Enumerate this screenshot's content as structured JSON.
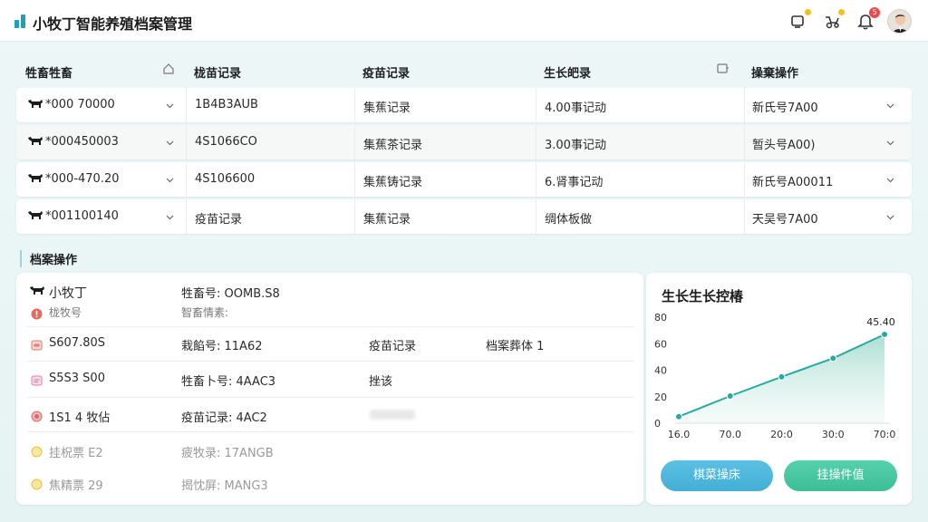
{
  "app": {
    "title": "小牧丁智能养殖档案管理"
  },
  "header": {
    "icons": [
      "device-icon",
      "tractor-icon",
      "bell-icon"
    ],
    "notification_count": "5",
    "colors": {
      "brand": "#1aa3b6",
      "badge": "#e84c4c",
      "dot": "#f2c21a"
    }
  },
  "table": {
    "columns": [
      "牲畜牲畜",
      "栊苗记录",
      "疫苗记录",
      "生长皅录",
      "操棄操作"
    ],
    "rows": [
      [
        "*000 70000",
        "1B4B3AUB",
        "集蕉记录",
        "4.00事记动",
        "新氏号7A00"
      ],
      [
        "*000450003",
        "4S1066CO",
        "集蕉茶记录",
        "3.00事记动",
        "暂头号A00)"
      ],
      [
        "*000-470.20",
        "4S106600",
        "集蕉铸记录",
        "6.肾事记动",
        "新氏号A00011"
      ],
      [
        "*001100140",
        "疫苗记录",
        "集蕉记录",
        "绸体板做",
        "天吴号7A00"
      ]
    ]
  },
  "section": {
    "title": "档案操作"
  },
  "detail": {
    "name": "小牧丁",
    "livestock_no": "牲畜号: OOMB.S8",
    "sub_label": "栊牧号",
    "smart_info": "智畜情素:",
    "rows": [
      {
        "left": "S607.80S",
        "mid": "栽餡号: 11A62",
        "c3": "疫苗记录",
        "c4": "档案葬体 1"
      },
      {
        "left": "S5S3 S00",
        "mid": "牲畜卜号: 4AAC3",
        "c3": "挫该",
        "c4": ""
      },
      {
        "left": "1S1 4 牧佔",
        "mid": "疫苗记录: 4AC2",
        "c3": "",
        "c4": ""
      },
      {
        "left": "挂柷票 E2",
        "mid": "疲牧录: 17ANGB",
        "c3": "",
        "c4": ""
      },
      {
        "left": "焦精票 29",
        "mid": "揭忱屏: MANG3",
        "c3": "",
        "c4": ""
      }
    ]
  },
  "chart_data": {
    "type": "line",
    "title": "生长生长控椿",
    "x_tick_labels": [
      "16.0",
      "70.0",
      "20:0",
      "30:0",
      "70:0"
    ],
    "y_ticks": [
      0,
      20,
      40,
      60,
      80
    ],
    "ylim": [
      0,
      80
    ],
    "values": [
      5,
      20.5,
      35,
      49,
      67
    ],
    "point_label": "45.40",
    "color": "#2aa9a2"
  },
  "buttons": {
    "primary": "棋菜操床",
    "secondary": "挂操件值"
  }
}
